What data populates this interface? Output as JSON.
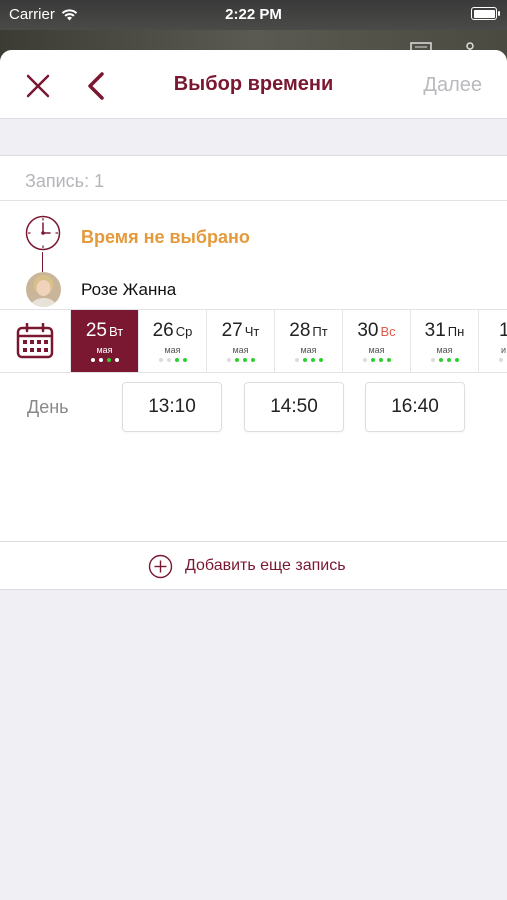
{
  "status_bar": {
    "carrier": "Carrier",
    "time": "2:22 PM"
  },
  "nav": {
    "title": "Выбор времени",
    "next_label": "Далее"
  },
  "entry": {
    "label": "Запись: 1",
    "time_status": "Время не выбрано",
    "master_name": "Розе Жанна"
  },
  "days": [
    {
      "num": "25",
      "dow": "Вт",
      "month": "мая",
      "dots": [
        "white",
        "white",
        "green",
        "white"
      ],
      "selected": true,
      "weekend": false
    },
    {
      "num": "26",
      "dow": "Ср",
      "month": "мая",
      "dots": [
        "grey",
        "grey",
        "green",
        "green"
      ],
      "selected": false,
      "weekend": false
    },
    {
      "num": "27",
      "dow": "Чт",
      "month": "мая",
      "dots": [
        "grey",
        "green",
        "green",
        "green"
      ],
      "selected": false,
      "weekend": false
    },
    {
      "num": "28",
      "dow": "Пт",
      "month": "мая",
      "dots": [
        "grey",
        "green",
        "green",
        "green"
      ],
      "selected": false,
      "weekend": false
    },
    {
      "num": "30",
      "dow": "Вс",
      "month": "мая",
      "dots": [
        "grey",
        "green",
        "green",
        "green"
      ],
      "selected": false,
      "weekend": true
    },
    {
      "num": "31",
      "dow": "Пн",
      "month": "мая",
      "dots": [
        "grey",
        "green",
        "green",
        "green"
      ],
      "selected": false,
      "weekend": false
    },
    {
      "num": "1",
      "dow": "",
      "month": "и",
      "dots": [
        "grey"
      ],
      "selected": false,
      "weekend": false
    }
  ],
  "slots": {
    "label": "День",
    "times": [
      "13:10",
      "14:50",
      "16:40"
    ]
  },
  "add_entry": {
    "label": "Добавить еще запись"
  },
  "colors": {
    "brand": "#7a1831",
    "warning": "#e49a3a",
    "available": "#2fcf2f",
    "weekend": "#e0584a"
  },
  "icons": {
    "close": "close-icon",
    "back": "chevron-left-icon",
    "clock": "clock-icon",
    "calendar": "calendar-icon",
    "add": "plus-circle-icon"
  }
}
